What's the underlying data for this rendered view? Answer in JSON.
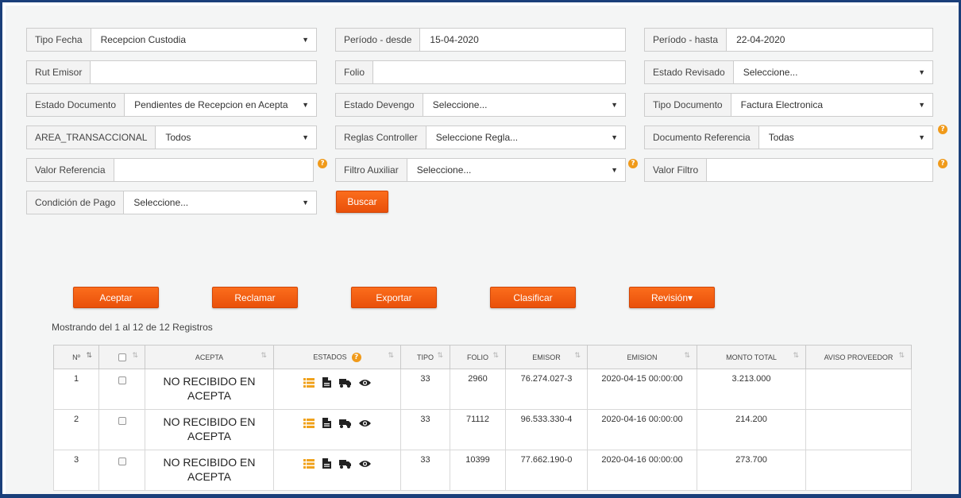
{
  "filters": {
    "tipo_fecha": {
      "label": "Tipo Fecha",
      "value": "Recepcion Custodia"
    },
    "periodo_desde": {
      "label": "Período - desde",
      "value": "15-04-2020"
    },
    "periodo_hasta": {
      "label": "Período - hasta",
      "value": "22-04-2020"
    },
    "rut_emisor": {
      "label": "Rut Emisor",
      "value": ""
    },
    "folio": {
      "label": "Folio",
      "value": ""
    },
    "estado_revisado": {
      "label": "Estado Revisado",
      "value": "Seleccione..."
    },
    "estado_documento": {
      "label": "Estado Documento",
      "value": "Pendientes de Recepcion en Acepta"
    },
    "estado_devengo": {
      "label": "Estado Devengo",
      "value": "Seleccione..."
    },
    "tipo_documento": {
      "label": "Tipo Documento",
      "value": "Factura Electronica"
    },
    "area_transaccional": {
      "label": "AREA_TRANSACCIONAL",
      "value": "Todos"
    },
    "reglas_controller": {
      "label": "Reglas Controller",
      "value": "Seleccione Regla..."
    },
    "documento_referencia": {
      "label": "Documento Referencia",
      "value": "Todas"
    },
    "valor_referencia": {
      "label": "Valor Referencia",
      "value": ""
    },
    "filtro_auxiliar": {
      "label": "Filtro Auxiliar",
      "value": "Seleccione..."
    },
    "valor_filtro": {
      "label": "Valor Filtro",
      "value": ""
    },
    "condicion_pago": {
      "label": "Condición de Pago",
      "value": "Seleccione..."
    },
    "caret": "▼",
    "help": "?"
  },
  "buttons": {
    "buscar": "Buscar",
    "aceptar": "Aceptar",
    "reclamar": "Reclamar",
    "exportar": "Exportar",
    "clasificar": "Clasificar",
    "revision": "Revisión▾"
  },
  "table": {
    "count_text": "Mostrando del 1 al 12 de 12 Registros",
    "headers": {
      "n": "Nº",
      "acepta": "ACEPTA",
      "estados": "ESTADOS",
      "tipo": "TIPO",
      "folio": "FOLIO",
      "emisor": "EMISOR",
      "emision": "EMISION",
      "monto_total": "MONTO TOTAL",
      "aviso_proveedor": "AVISO PROVEEDOR"
    },
    "rows": [
      {
        "n": "1",
        "acepta": "NO RECIBIDO EN ACEPTA",
        "tipo": "33",
        "folio": "2960",
        "emisor": "76.274.027-3",
        "emision": "2020-04-15 00:00:00",
        "monto_total": "3.213.000",
        "aviso_proveedor": ""
      },
      {
        "n": "2",
        "acepta": "NO RECIBIDO EN ACEPTA",
        "tipo": "33",
        "folio": "71112",
        "emisor": "96.533.330-4",
        "emision": "2020-04-16 00:00:00",
        "monto_total": "214.200",
        "aviso_proveedor": ""
      },
      {
        "n": "3",
        "acepta": "NO RECIBIDO EN ACEPTA",
        "tipo": "33",
        "folio": "10399",
        "emisor": "77.662.190-0",
        "emision": "2020-04-16 00:00:00",
        "monto_total": "273.700",
        "aviso_proveedor": ""
      }
    ]
  },
  "colors": {
    "accent": "#f3600f",
    "icon_orange": "#f0a21c",
    "frame": "#1a3f7a"
  }
}
